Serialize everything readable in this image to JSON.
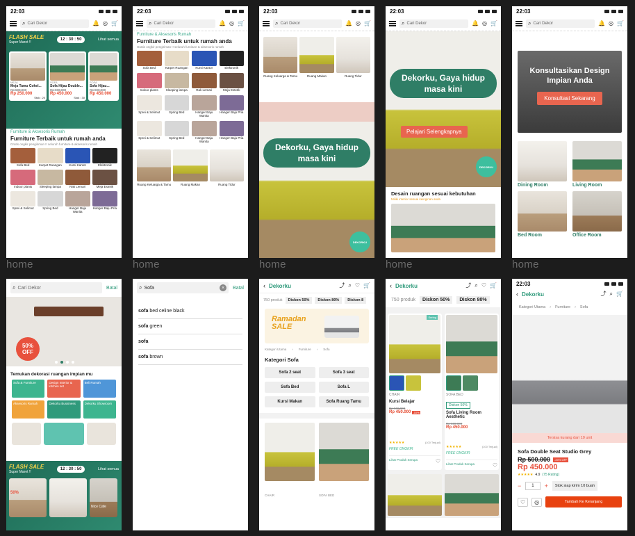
{
  "status_time": "22:03",
  "screen_label": "home",
  "search_placeholder": "Cari Dekor",
  "s1": {
    "flash_title": "FLASH SALE",
    "flash_sub": "Super Maret !!",
    "timer": "12 : 30 : 50",
    "see_all": "Lihat semua",
    "products": [
      {
        "brand": "MEJA",
        "name": "Meja Tamu Cokel...",
        "old": "Rp 500.000",
        "price": "Rp 250.000",
        "stock": "Stok : 20"
      },
      {
        "brand": "SOFA",
        "name": "Sofa Hijau Double...",
        "old": "Rp 900.000",
        "price": "Rp 450.000",
        "stock": "Stok : 30"
      },
      {
        "brand": "SOFA",
        "name": "Sofa Hijau...",
        "old": "Rp 900.000",
        "price": "Rp 450.000",
        "stock": ""
      }
    ],
    "sec_small": "Furniture & Aksesoris Rumah",
    "sec_title": "Furniture Terbaik untuk rumah anda",
    "sec_sub": "Gratis ongkir pengiriman !! seluruh furniture & aksesoris rumah",
    "cats": [
      "Sofa Bed",
      "Karpet Ruangan",
      "Kursi Kantor",
      "Elektronik",
      "Indoor plants",
      "Sleeping lampa",
      "Rak Lemari",
      "Meja Estetik",
      "Sprei & Selimut",
      "Spring Bed",
      "Hanger Baju Wanita",
      "Hanger Baju Pria"
    ]
  },
  "s2": {
    "sec_small": "Furniture & Aksesoris Rumah",
    "sec_title": "Furniture Terbaik untuk rumah anda",
    "sec_sub": "Gratis ongkir pengiriman !! seluruh furniture & aksesoris rumah",
    "cats": [
      "Sofa Bed",
      "Karpet Ruangan",
      "Kursi Kantor",
      "Elektronik",
      "Indoor plants",
      "Sleeping lampa",
      "Rak Lemari",
      "Meja Estetik",
      "Sprei & Selimut",
      "Spring Bed",
      "Hanger Baju Wanita",
      "Hanger Baju Pria",
      "Sprei & Selimut",
      "Spring Bed",
      "Hanger Baju Wanita",
      "Hanger Baju Pria"
    ],
    "rooms": [
      "Ruang Keluarga & Tamu",
      "Ruang Makan",
      "Ruang Tidur"
    ]
  },
  "s3": {
    "rooms": [
      "Ruang Keluarga & Tamu",
      "Ruang Makan",
      "Ruang Tidur"
    ],
    "hero": "Dekorku, Gaya hidup masa kini",
    "badge": "DEKORKU"
  },
  "s4": {
    "hero": "Dekorku, Gaya hidup masa kini",
    "cta": "Pelajari Selengkapnya",
    "badge": "DEKORKU",
    "desc_title": "Desain ruangan sesuai kebutuhan",
    "desc_sub": "Miliki interior sesuai keinginan anda"
  },
  "s5": {
    "consult_title": "Konsultasikan Design Impian Anda",
    "consult_cta": "Konsultasi Sekarang",
    "rooms": [
      "Dining Room",
      "Living Room",
      "Bed Room",
      "Office Room"
    ]
  },
  "s6": {
    "cancel": "Batal",
    "discount": "50% OFF",
    "section": "Temukan dekorasi ruangan impian mu",
    "tiles": [
      "Sofa & Furniture",
      "Design Interior & kitchen set",
      "Beli Rumah",
      "Aksesoris Rumah",
      "Dekorku Bussiness",
      "Dekorku Showroom"
    ],
    "flash_title": "FLASH SALE",
    "flash_sub": "Super Maret !!",
    "timer": "12 : 30 : 50",
    "see_all": "Lihat semua",
    "cards": [
      "50%",
      "",
      "Nice Cafe"
    ]
  },
  "s7": {
    "query": "Sofa",
    "cancel": "Batal",
    "suggestions": [
      {
        "bold": "sofa",
        "rest": " bed celine black"
      },
      {
        "bold": "sofa",
        "rest": " green"
      },
      {
        "bold": "sofa",
        "rest": ""
      },
      {
        "bold": "sofa",
        "rest": " brown"
      }
    ]
  },
  "s8": {
    "title": "Dekorku",
    "count": "750 produk",
    "filters": [
      "Diskon 50%",
      "Diskon 80%",
      "Diskon 8"
    ],
    "banner": "Ramadan SALE",
    "crumbs": [
      "Kategori Utama",
      "Furniture",
      "Sofa"
    ],
    "cat_title": "Kategori Sofa",
    "chips": [
      "Sofa 2 seat",
      "Sofa 3 seat",
      "Sofa Bed",
      "Sofa L",
      "Kursi Makan",
      "Sofa Ruang Tamu"
    ],
    "tags": [
      "CHAIR",
      "SOFA BED"
    ]
  },
  "s9": {
    "title": "Dekorku",
    "count": "750 produk",
    "filters": [
      "Diskon 50%",
      "Diskon 80%"
    ],
    "p1": {
      "tag": "CHAIR",
      "name": "Kursi Belajar",
      "old": "Rp 500.000",
      "price": "Rp 450.000",
      "disc": "-10%",
      "sold": "(100 Terjual)",
      "ship": "FREE ONGKIR",
      "similar": "Lihat Produk Serupa"
    },
    "p2": {
      "tag": "SOFA BED",
      "badge": "Diskon 50%",
      "name": "Sofa Living Room Aesthetic",
      "old": "Rp 500.000",
      "price": "Rp 450.000",
      "sold": "(100 Terjual)",
      "ship": "FREE ONGKIR",
      "similar": "Lihat Produk Serupa"
    },
    "ribbon": "Sering"
  },
  "s10": {
    "title": "Dekorku",
    "crumbs": [
      "Kategori Utama",
      "Furniture",
      "Sofa"
    ],
    "stock_note": "Tersisa kurang dari 10 unit",
    "name": "Sofa Double Seat Studio Grey",
    "old": "Rp 500.000",
    "disc": "-20% OFF",
    "price": "Rp 450.000",
    "rating": "4.9",
    "ratings": "(75 Rating)",
    "qty": "1",
    "ship_note": "Stok siap kirim 10 buah",
    "cart_btn": "Tambah Ke Keranjang"
  }
}
